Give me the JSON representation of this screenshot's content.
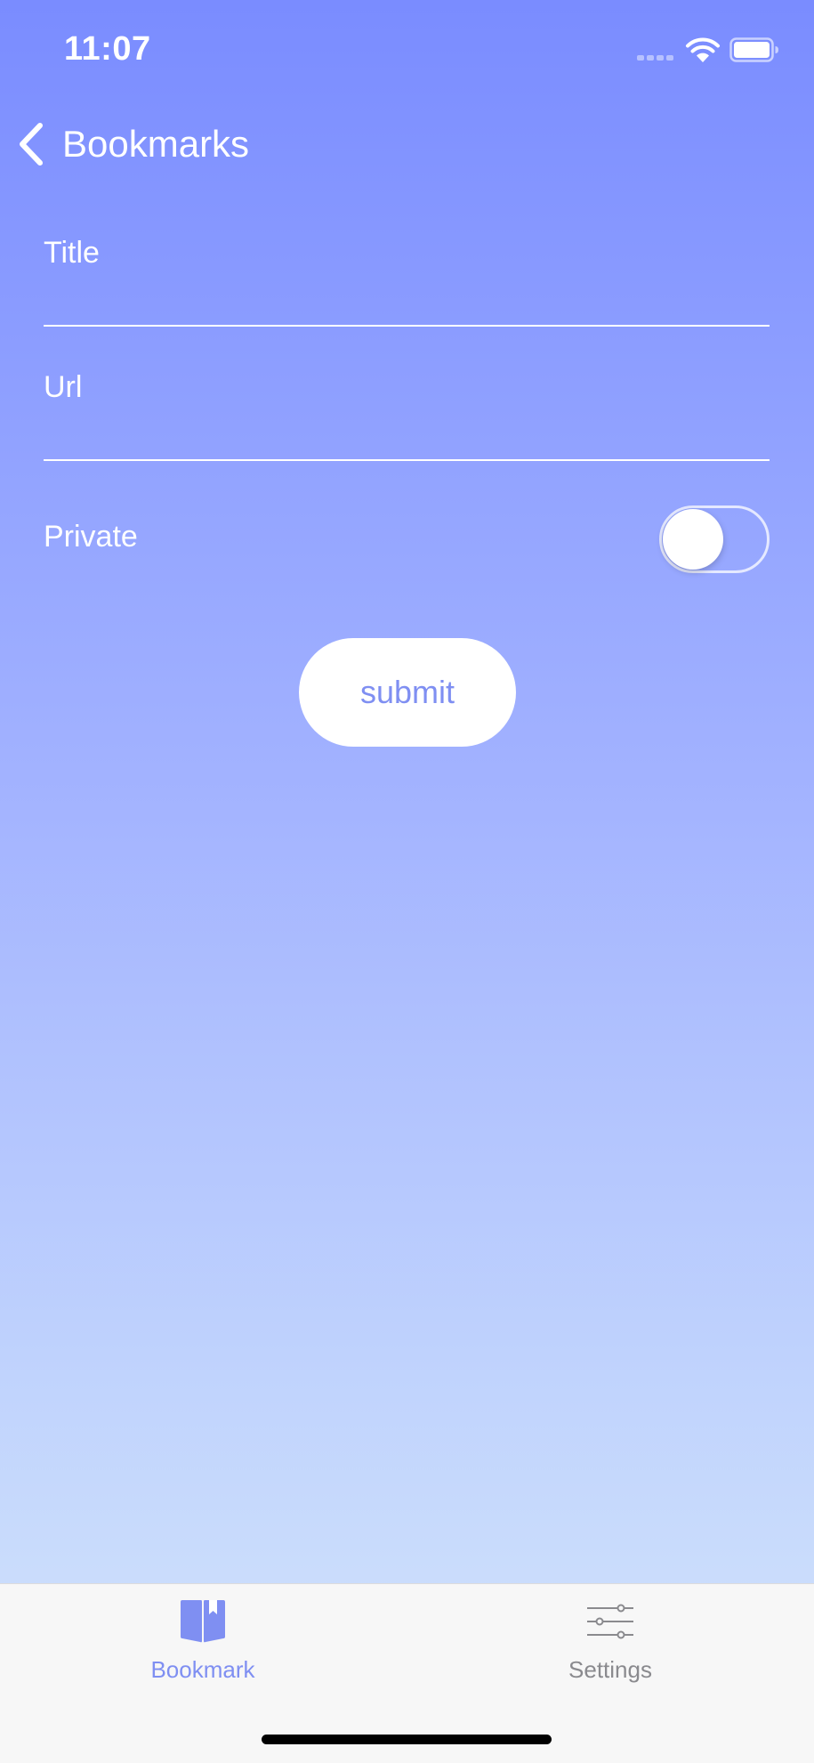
{
  "status_bar": {
    "time": "11:07"
  },
  "nav": {
    "back_label": "Bookmarks",
    "back_icon": "chevron-left-icon"
  },
  "form": {
    "title_label": "Title",
    "title_value": "",
    "url_label": "Url",
    "url_value": "",
    "private_label": "Private",
    "private_enabled": false,
    "submit_label": "submit"
  },
  "tab_bar": {
    "items": [
      {
        "label": "Bookmark",
        "icon": "book-bookmark-icon",
        "active": true
      },
      {
        "label": "Settings",
        "icon": "sliders-icon",
        "active": false
      }
    ]
  },
  "colors": {
    "gradient_top": "#7a8cff",
    "gradient_bottom": "#d3e5fb",
    "accent": "#7f8ff2",
    "inactive_tab": "#8a8a8e",
    "tab_bar_bg": "#f7f7f7"
  }
}
